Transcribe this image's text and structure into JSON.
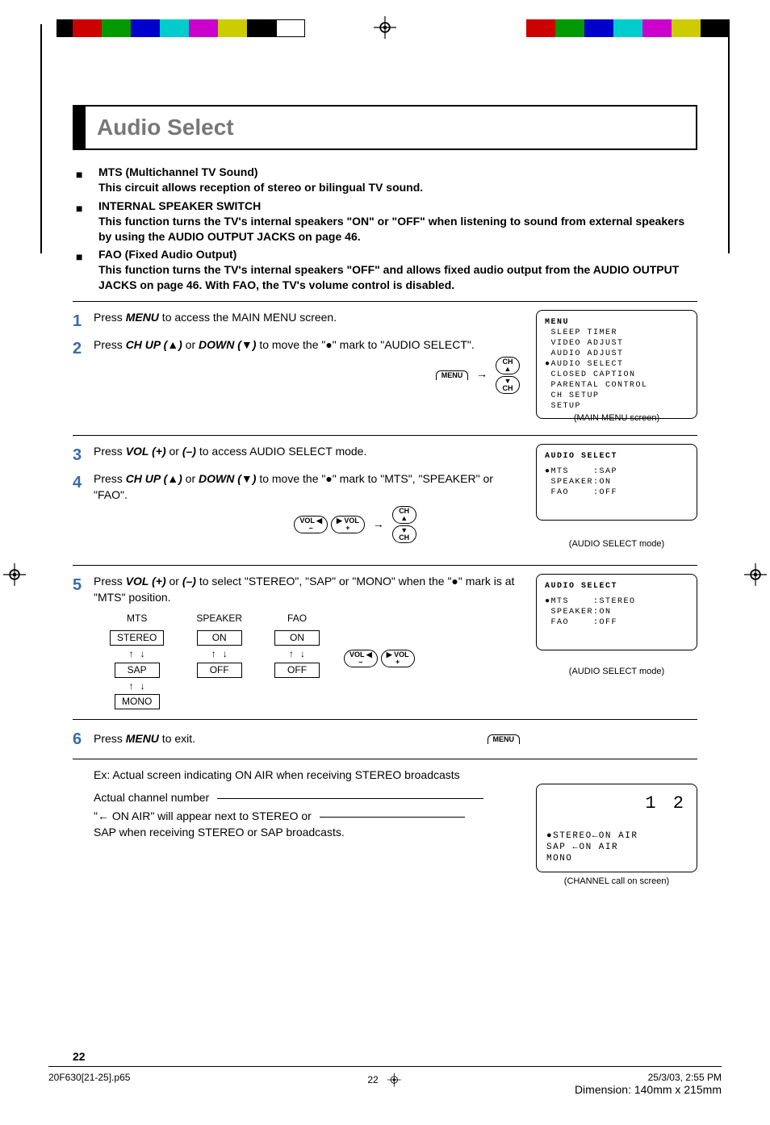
{
  "title": "Audio Select",
  "intro": {
    "items": [
      {
        "head": "MTS (Multichannel TV Sound)",
        "sub": "This circuit allows reception of stereo or bilingual TV sound."
      },
      {
        "head": "INTERNAL SPEAKER SWITCH",
        "sub": "This function turns the TV's internal speakers \"ON\" or \"OFF\" when listening to sound from external speakers by using the AUDIO OUTPUT JACKS on page 46."
      },
      {
        "head": "FAO (Fixed Audio Output)",
        "sub": "This function turns the TV's internal speakers \"OFF\" and allows fixed audio output from the AUDIO OUTPUT JACKS on page 46. With FAO, the TV's volume control is disabled."
      }
    ]
  },
  "steps": {
    "s1": {
      "num": "1",
      "pre": "Press ",
      "key": "MENU",
      "post": " to access the MAIN MENU screen."
    },
    "s2": {
      "num": "2",
      "pre": "Press ",
      "k1": "CH UP (▲)",
      "or": " or ",
      "k2": "DOWN (▼)",
      "post": " to move the \"●\" mark to \"AUDIO SELECT\"."
    },
    "s3": {
      "num": "3",
      "pre": "Press ",
      "k1": "VOL (+)",
      "or": " or ",
      "k2": "(–)",
      "post": " to access AUDIO SELECT mode."
    },
    "s4": {
      "num": "4",
      "pre": "Press ",
      "k1": "CH UP (▲)",
      "or": " or ",
      "k2": "DOWN (▼)",
      "post": " to move the \"●\" mark to \"MTS\", \"SPEAKER\" or \"FAO\"."
    },
    "s5": {
      "num": "5",
      "pre": "Press ",
      "k1": "VOL (+)",
      "or": " or ",
      "k2": "(–)",
      "post": " to select \"STEREO\", \"SAP\" or \"MONO\" when the \"●\" mark is at \"MTS\" position."
    },
    "s6": {
      "num": "6",
      "pre": "Press ",
      "key": "MENU",
      "post": " to exit."
    }
  },
  "buttons": {
    "menu": "MENU",
    "ch_up": "CH\n▲",
    "ch_dn": "▼\nCH",
    "vol_m": "VOL ◀\n–",
    "vol_p": "▶ VOL\n+"
  },
  "screens": {
    "main_menu": {
      "title": "MENU",
      "lines": [
        " SLEEP TIMER",
        " VIDEO ADJUST",
        " AUDIO ADJUST",
        "●AUDIO SELECT",
        " CLOSED CAPTION",
        " PARENTAL CONTROL",
        " CH SETUP",
        " SETUP"
      ],
      "caption": "(MAIN MENU screen)"
    },
    "audio1": {
      "title": "AUDIO SELECT",
      "lines": [
        "●MTS    :SAP",
        " SPEAKER:ON",
        " FAO    :OFF"
      ],
      "caption": "(AUDIO SELECT mode)"
    },
    "audio2": {
      "title": "AUDIO SELECT",
      "lines": [
        "●MTS    :STEREO",
        " SPEAKER:ON",
        " FAO    :OFF"
      ],
      "caption": "(AUDIO SELECT mode)"
    }
  },
  "options": {
    "mts": {
      "label": "MTS",
      "values": [
        "STEREO",
        "SAP",
        "MONO"
      ]
    },
    "speaker": {
      "label": "SPEAKER",
      "values": [
        "ON",
        "OFF"
      ]
    },
    "fao": {
      "label": "FAO",
      "values": [
        "ON",
        "OFF"
      ]
    }
  },
  "example": {
    "line1": "Ex: Actual screen indicating ON AIR when receiving STEREO broadcasts",
    "line2": "Actual channel number",
    "line3": "\"← ON AIR\" will appear next to STEREO or",
    "line4": "SAP when receiving STEREO or SAP broadcasts.",
    "ch_num": "1 2",
    "ch_lines": [
      "●STEREO←ON AIR",
      " SAP   ←ON AIR",
      " MONO"
    ],
    "ch_caption": "(CHANNEL call on screen)"
  },
  "page_num": "22",
  "footer": {
    "left": "20F630[21-25].p65",
    "mid_num": "22",
    "right_date": "25/3/03, 2:55 PM",
    "right_dim": "Dimension: 140mm x 215mm"
  }
}
